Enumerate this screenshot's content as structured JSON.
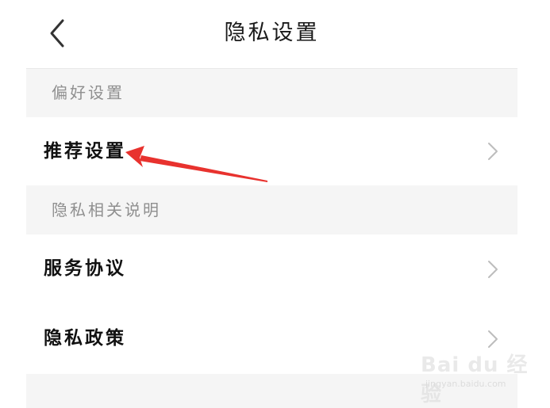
{
  "header": {
    "title": "隐私设置",
    "back_icon": "chevron-left-icon"
  },
  "sections": [
    {
      "label": "偏好设置",
      "items": [
        {
          "label": "推荐设置",
          "icon": "chevron-right-icon"
        }
      ]
    },
    {
      "label": "隐私相关说明",
      "items": [
        {
          "label": "服务协议",
          "icon": "chevron-right-icon"
        },
        {
          "label": "隐私政策",
          "icon": "chevron-right-icon"
        }
      ]
    }
  ],
  "annotation": {
    "type": "red-arrow",
    "color": "#e8322e",
    "points_to": "推荐设置"
  },
  "watermark": {
    "logo": "Bai du 经验",
    "url": "jingyan.baidu.com"
  },
  "colors": {
    "page_bg": "#f5f5f5",
    "row_bg": "#ffffff",
    "section_text": "#8f8f8f",
    "row_text": "#111111",
    "chevron": "#bdbdbd"
  }
}
